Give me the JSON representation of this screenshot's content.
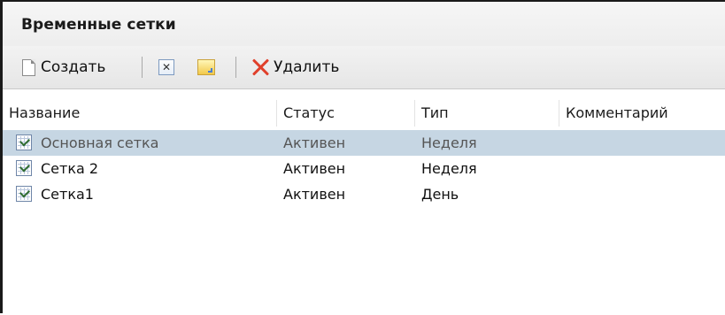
{
  "panel": {
    "title": "Временные сетки"
  },
  "toolbar": {
    "create_label": "Создать",
    "delete_label": "Удалить",
    "icons": [
      "new-document-icon",
      "close-box-icon",
      "folder-edit-icon",
      "delete-x-icon"
    ]
  },
  "grid": {
    "columns": [
      "Название",
      "Статус",
      "Тип",
      "Комментарий"
    ],
    "rows": [
      {
        "name": "Основная сетка",
        "status": "Активен",
        "type": "Неделя",
        "comment": "",
        "selected": true
      },
      {
        "name": "Сетка 2",
        "status": "Активен",
        "type": "Неделя",
        "comment": "",
        "selected": false
      },
      {
        "name": "Сетка1",
        "status": "Активен",
        "type": "День",
        "comment": "",
        "selected": false
      }
    ]
  },
  "colors": {
    "selection": "#c6d6e3",
    "delete_accent": "#e0402b"
  }
}
